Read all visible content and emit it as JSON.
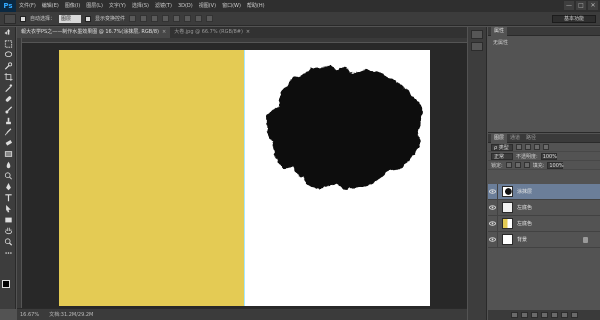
{
  "menubar": {
    "logo": "Ps",
    "items": [
      "文件(F)",
      "编辑(E)",
      "图像(I)",
      "图层(L)",
      "文字(Y)",
      "选择(S)",
      "滤镜(T)",
      "3D(D)",
      "视图(V)",
      "窗口(W)",
      "帮助(H)"
    ],
    "win_buttons": [
      "—",
      "□",
      "✕"
    ]
  },
  "options": {
    "auto_select_label": "自动选择：",
    "auto_select_value": "图层",
    "show_transform_label": "显示变换控件",
    "workspace": "基本功能"
  },
  "tabs": [
    {
      "label": "報大衣学PS之——制作水墨效果图 @ 16.7%(涂抹层, RGB/8)"
    },
    {
      "label": "大卷.jpg @ 66.7% (RGB/8#)"
    }
  ],
  "status": {
    "zoom": "16.67%",
    "doc_info": "文档:31.2M/29.2M"
  },
  "properties": {
    "tabs": [
      "属性"
    ],
    "empty_label": "无属性"
  },
  "layers": {
    "tabs": [
      "图层",
      "通道",
      "路径"
    ],
    "kind_filter": "ρ 类型",
    "blend_mode": "正常",
    "opacity_label": "不透明度:",
    "opacity_value": "100%",
    "lock_label": "锁定:",
    "fill_label": "填充:",
    "fill_value": "100%",
    "items": [
      {
        "name": "涂抹层",
        "selected": true
      },
      {
        "name": "左底色",
        "selected": false
      },
      {
        "name": "左底色",
        "selected": false
      },
      {
        "name": "背景",
        "selected": false
      }
    ]
  },
  "colors": {
    "yellow": "#e4cb54",
    "ink": "#111111",
    "selection": "#6b7e99"
  }
}
